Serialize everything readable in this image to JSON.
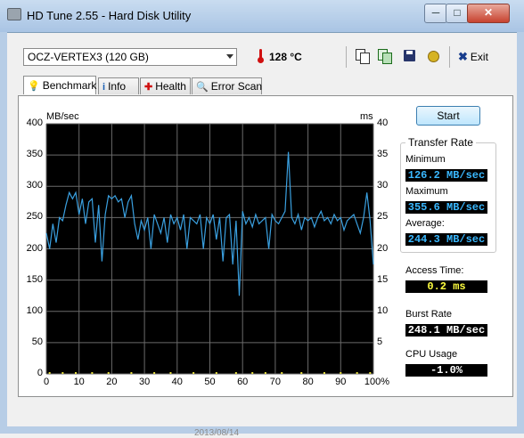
{
  "window": {
    "title": "HD Tune 2.55 - Hard Disk Utility",
    "min_label": "─",
    "max_label": "□",
    "close_label": "✕"
  },
  "toolbar": {
    "drive": "OCZ-VERTEX3 (120 GB)",
    "temperature": "128 °C",
    "exit_label": "Exit"
  },
  "tabs": [
    {
      "label": "Benchmark",
      "icon": "lightbulb-icon",
      "active": true
    },
    {
      "label": "Info",
      "icon": "info-icon",
      "active": false
    },
    {
      "label": "Health",
      "icon": "health-cross-icon",
      "active": false
    },
    {
      "label": "Error Scan",
      "icon": "magnifier-icon",
      "active": false
    }
  ],
  "start_button": "Start",
  "results": {
    "transfer_rate_title": "Transfer Rate",
    "minimum_label": "Minimum",
    "minimum_value": "126.2 MB/sec",
    "maximum_label": "Maximum",
    "maximum_value": "355.6 MB/sec",
    "average_label": "Average:",
    "average_value": "244.3 MB/sec",
    "access_time_label": "Access Time:",
    "access_time_value": "0.2 ms",
    "burst_rate_label": "Burst Rate",
    "burst_rate_value": "248.1 MB/sec",
    "cpu_usage_label": "CPU Usage",
    "cpu_usage_value": "-1.0%"
  },
  "colors": {
    "chart_bg": "#000000",
    "grid": "#6a6a6a",
    "transfer_line": "#3aa0e0",
    "access_points": "#e8e040"
  },
  "chart_data": {
    "type": "line",
    "ylabel": "MB/sec",
    "y2label": "ms",
    "ylim": [
      0,
      400
    ],
    "y2lim": [
      0,
      40
    ],
    "xlim": [
      0,
      100
    ],
    "y_ticks": [
      "400",
      "350",
      "300",
      "250",
      "200",
      "150",
      "100",
      "50",
      "0"
    ],
    "y2_ticks": [
      "40",
      "35",
      "30",
      "25",
      "20",
      "15",
      "10",
      "5"
    ],
    "x_ticks": [
      "0",
      "10",
      "20",
      "30",
      "40",
      "50",
      "60",
      "70",
      "80",
      "90",
      "100%"
    ],
    "grid": true,
    "series": [
      {
        "values": [
          [
            0,
            225
          ],
          [
            1,
            200
          ],
          [
            2,
            240
          ],
          [
            3,
            210
          ],
          [
            4,
            250
          ],
          [
            5,
            245
          ],
          [
            6,
            270
          ],
          [
            7,
            290
          ],
          [
            8,
            280
          ],
          [
            9,
            290
          ],
          [
            10,
            255
          ],
          [
            11,
            280
          ],
          [
            12,
            240
          ],
          [
            13,
            275
          ],
          [
            14,
            280
          ],
          [
            15,
            210
          ],
          [
            16,
            270
          ],
          [
            17,
            180
          ],
          [
            18,
            255
          ],
          [
            19,
            285
          ],
          [
            20,
            280
          ],
          [
            21,
            285
          ],
          [
            22,
            275
          ],
          [
            23,
            280
          ],
          [
            24,
            250
          ],
          [
            25,
            275
          ],
          [
            26,
            285
          ],
          [
            27,
            240
          ],
          [
            28,
            215
          ],
          [
            29,
            245
          ],
          [
            30,
            230
          ],
          [
            31,
            250
          ],
          [
            32,
            200
          ],
          [
            33,
            255
          ],
          [
            34,
            240
          ],
          [
            35,
            225
          ],
          [
            36,
            250
          ],
          [
            37,
            210
          ],
          [
            38,
            255
          ],
          [
            39,
            240
          ],
          [
            40,
            250
          ],
          [
            41,
            230
          ],
          [
            42,
            255
          ],
          [
            43,
            200
          ],
          [
            44,
            250
          ],
          [
            45,
            245
          ],
          [
            46,
            240
          ],
          [
            47,
            255
          ],
          [
            48,
            200
          ],
          [
            49,
            250
          ],
          [
            50,
            240
          ],
          [
            51,
            255
          ],
          [
            52,
            215
          ],
          [
            53,
            250
          ],
          [
            54,
            180
          ],
          [
            55,
            250
          ],
          [
            56,
            255
          ],
          [
            57,
            175
          ],
          [
            58,
            245
          ],
          [
            59,
            125
          ],
          [
            60,
            260
          ],
          [
            61,
            240
          ],
          [
            62,
            250
          ],
          [
            63,
            235
          ],
          [
            64,
            255
          ],
          [
            65,
            240
          ],
          [
            66,
            245
          ],
          [
            67,
            250
          ],
          [
            68,
            200
          ],
          [
            69,
            255
          ],
          [
            70,
            245
          ],
          [
            71,
            240
          ],
          [
            72,
            250
          ],
          [
            73,
            260
          ],
          [
            74,
            355
          ],
          [
            75,
            250
          ],
          [
            76,
            240
          ],
          [
            77,
            255
          ],
          [
            78,
            230
          ],
          [
            79,
            250
          ],
          [
            80,
            245
          ],
          [
            81,
            250
          ],
          [
            82,
            235
          ],
          [
            83,
            250
          ],
          [
            84,
            260
          ],
          [
            85,
            245
          ],
          [
            86,
            250
          ],
          [
            87,
            240
          ],
          [
            88,
            255
          ],
          [
            89,
            245
          ],
          [
            90,
            250
          ],
          [
            91,
            230
          ],
          [
            92,
            245
          ],
          [
            93,
            250
          ],
          [
            94,
            255
          ],
          [
            95,
            240
          ],
          [
            96,
            225
          ],
          [
            97,
            250
          ],
          [
            98,
            290
          ],
          [
            99,
            245
          ],
          [
            100,
            175
          ]
        ]
      }
    ],
    "access_points": [
      1,
      5,
      9,
      14,
      19,
      26,
      33,
      38,
      45,
      52,
      58,
      63,
      67,
      72,
      78,
      85,
      90,
      95,
      99
    ]
  },
  "background_text": {
    "date": "2013/08/14"
  }
}
